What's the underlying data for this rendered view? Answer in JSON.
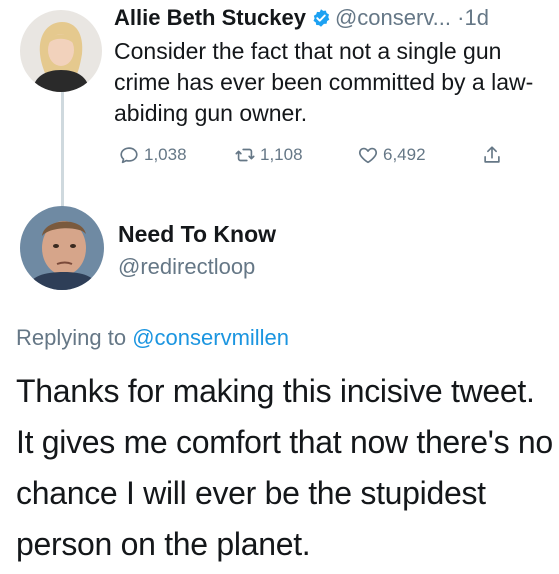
{
  "original_tweet": {
    "display_name": "Allie Beth Stuckey",
    "handle": "@conserv...",
    "separator": "·",
    "time_ago": "1d",
    "text": "Consider the fact that not a single gun crime has ever been committed by a law-abiding gun owner.",
    "avatar_icon": "avatar-woman-photo",
    "verified_icon": "verified-badge-icon",
    "counts": {
      "replies": "1,038",
      "retweets": "1,108",
      "likes": "6,492"
    }
  },
  "reply_tweet": {
    "display_name": "Need To Know",
    "handle": "@redirectloop",
    "avatar_icon": "avatar-man-photo",
    "replying_prefix": "Replying to",
    "replying_to": "@conservmillen",
    "text": "Thanks for making this incisive tweet. It gives me comfort that now there's no chance I will ever be the stupidest person on the planet."
  },
  "colors": {
    "text": "#14171a",
    "muted": "#657786",
    "link": "#1b95e0",
    "verified": "#1da1f2",
    "thread_line": "#cfd9de"
  }
}
